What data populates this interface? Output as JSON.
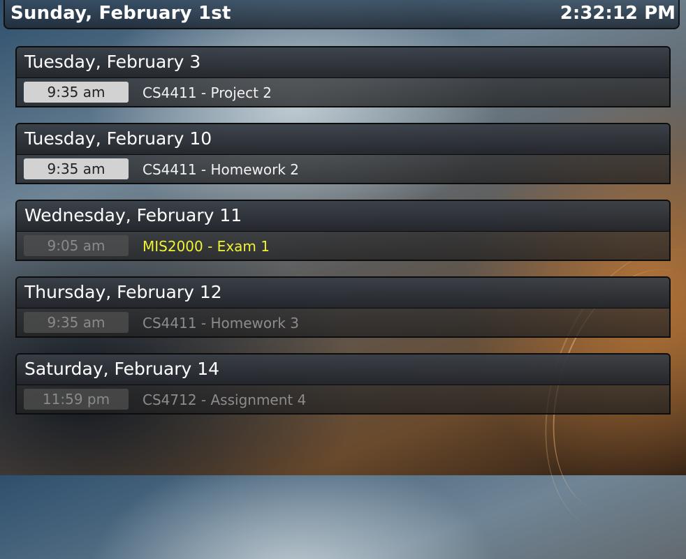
{
  "header": {
    "date": "Sunday, February 1st",
    "time": "2:32:12 PM"
  },
  "events": [
    {
      "day": "Tuesday, February 3",
      "time": "9:35 am",
      "title": "CS4411 - Project 2",
      "state": "normal"
    },
    {
      "day": "Tuesday, February 10",
      "time": "9:35 am",
      "title": "CS4411 - Homework 2",
      "state": "normal"
    },
    {
      "day": "Wednesday, February 11",
      "time": "9:05 am",
      "title": "MIS2000 - Exam 1",
      "state": "alert"
    },
    {
      "day": "Thursday, February 12",
      "time": "9:35 am",
      "title": "CS4411 - Homework 3",
      "state": "faded"
    },
    {
      "day": "Saturday, February 14",
      "time": "11:59 pm",
      "title": "CS4712 - Assignment 4",
      "state": "faded"
    }
  ],
  "colors": {
    "alert": "#f2f230",
    "active_pill": "#d2d2d2",
    "faded_text": "#8c8c8c"
  }
}
